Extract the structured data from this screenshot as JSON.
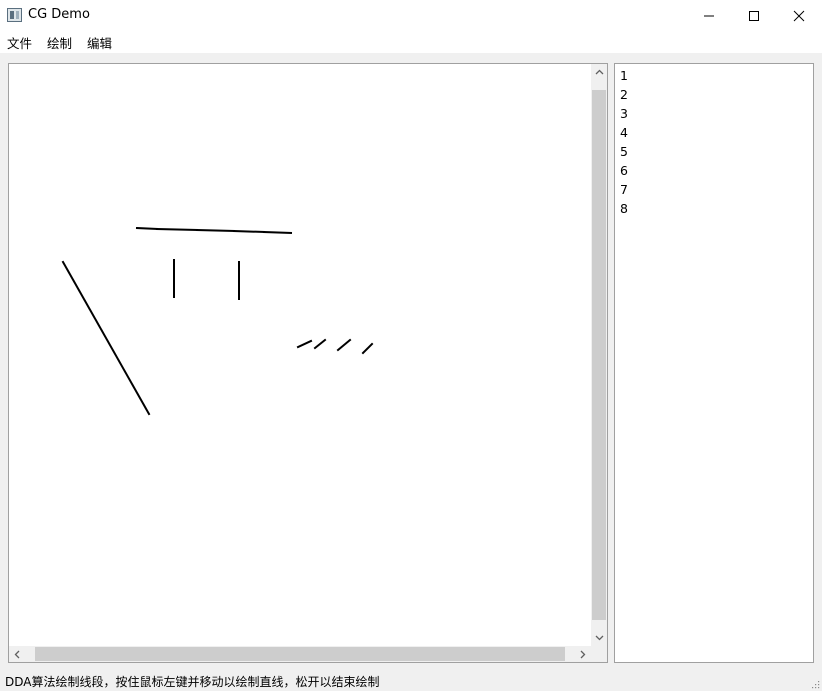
{
  "window": {
    "title": "CG Demo",
    "icons": {
      "app": "app-window-icon",
      "minimize": "minimize-icon",
      "maximize": "maximize-icon",
      "close": "close-icon"
    }
  },
  "menu": {
    "items": [
      {
        "label": "文件"
      },
      {
        "label": "绘制"
      },
      {
        "label": "编辑"
      }
    ]
  },
  "canvas": {
    "stroke_color": "#000000",
    "background": "#ffffff",
    "lines": [
      [
        128,
        164,
        148,
        165
      ],
      [
        148,
        165,
        188,
        166
      ],
      [
        188,
        166,
        225,
        167
      ],
      [
        225,
        167,
        255,
        168
      ],
      [
        255,
        168,
        282,
        169
      ],
      [
        165,
        196,
        165,
        233
      ],
      [
        230,
        198,
        230,
        235
      ],
      [
        54,
        198,
        140,
        350
      ],
      [
        289,
        283,
        302,
        277
      ],
      [
        306,
        284,
        316,
        276
      ],
      [
        329,
        286,
        341,
        276
      ],
      [
        354,
        289,
        363,
        280
      ]
    ]
  },
  "list": {
    "items": [
      "1",
      "2",
      "3",
      "4",
      "5",
      "6",
      "7",
      "8"
    ]
  },
  "status": {
    "text": "DDA算法绘制线段，按住鼠标左键并移动以绘制直线，松开以结束绘制"
  }
}
